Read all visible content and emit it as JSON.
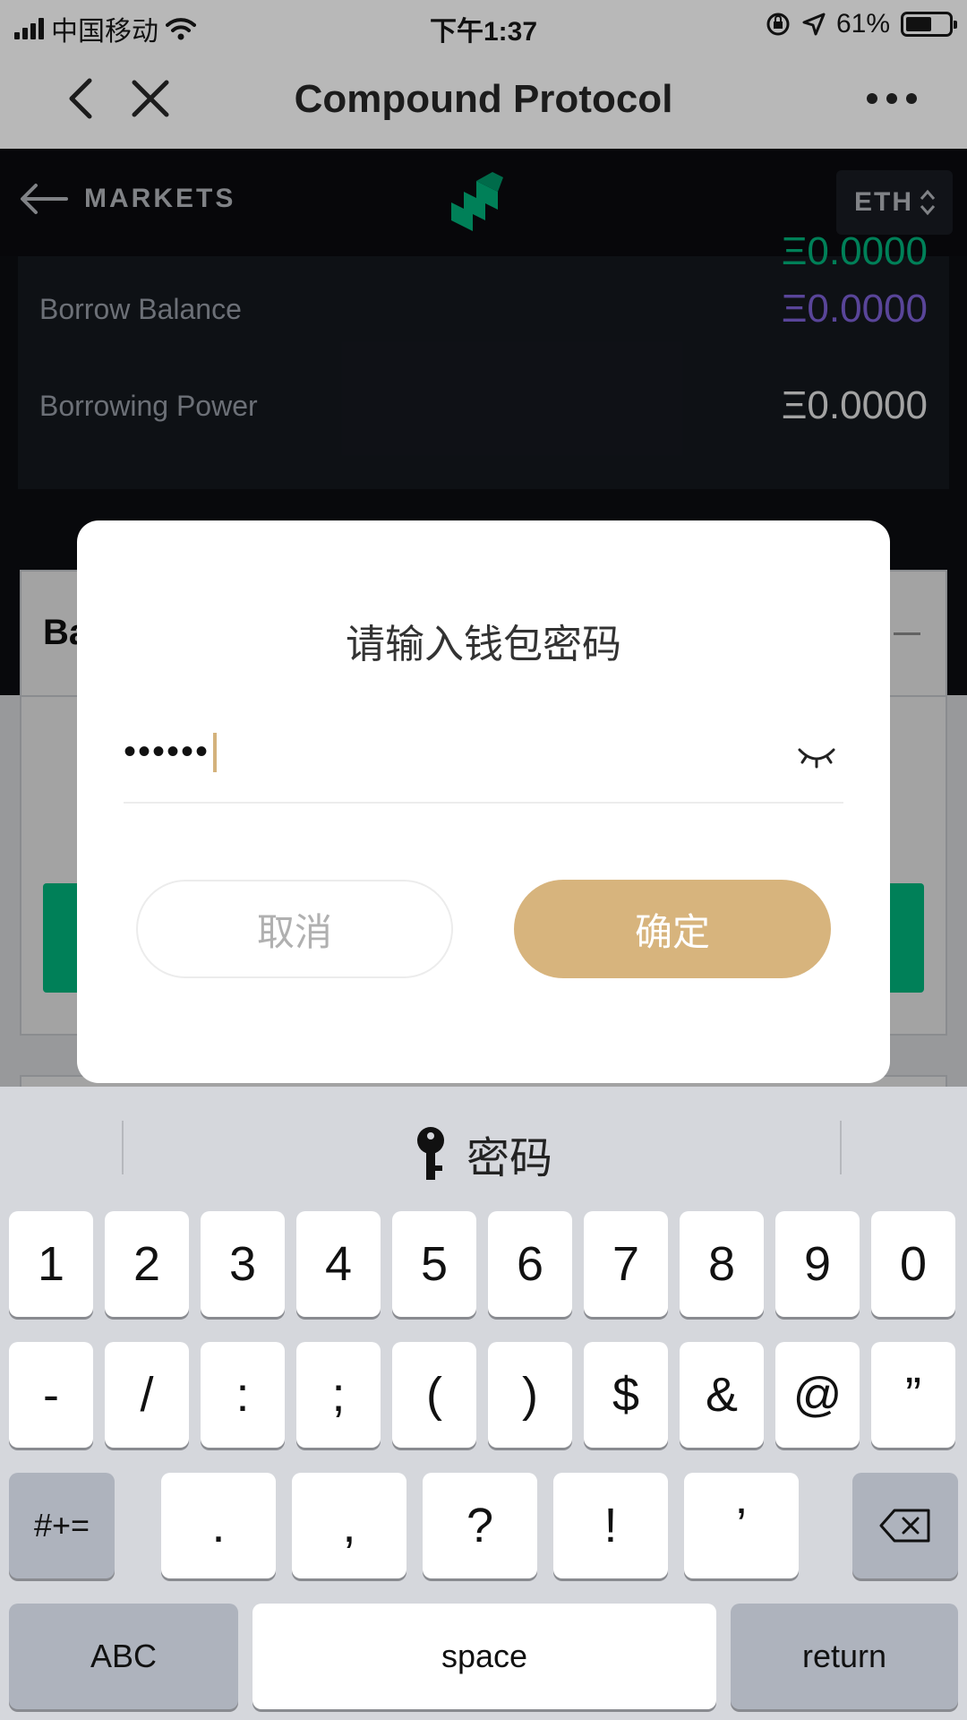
{
  "status_bar": {
    "carrier": "中国移动",
    "time": "下午1:37",
    "battery": "61%",
    "battery_level": 0.61
  },
  "nav": {
    "title": "Compound Protocol"
  },
  "app_header": {
    "back_label": "MARKETS",
    "currency": "ETH"
  },
  "balances": {
    "supply_value": "Ξ0.0000",
    "rows": [
      {
        "label": "Borrow Balance",
        "value": "Ξ0.0000",
        "color": "#8b6cf0"
      },
      {
        "label": "Borrowing Power",
        "value": "Ξ0.0000",
        "color": "#ffffff"
      }
    ]
  },
  "card": {
    "title_partial": "Ba"
  },
  "dialog": {
    "title": "请输入钱包密码",
    "password_mask": "••••••",
    "cancel_label": "取消",
    "confirm_label": "确定",
    "accent_color": "#d7b47d"
  },
  "keyboard": {
    "suggestion": "密码",
    "row1": [
      "1",
      "2",
      "3",
      "4",
      "5",
      "6",
      "7",
      "8",
      "9",
      "0"
    ],
    "row2": [
      "-",
      "/",
      ":",
      ";",
      "(",
      ")",
      "$",
      "&",
      "@",
      "”"
    ],
    "row3_toggle": "#+=",
    "row3": [
      ".",
      ",",
      "?",
      "!",
      "’"
    ],
    "abc_label": "ABC",
    "space_label": "space",
    "return_label": "return"
  }
}
